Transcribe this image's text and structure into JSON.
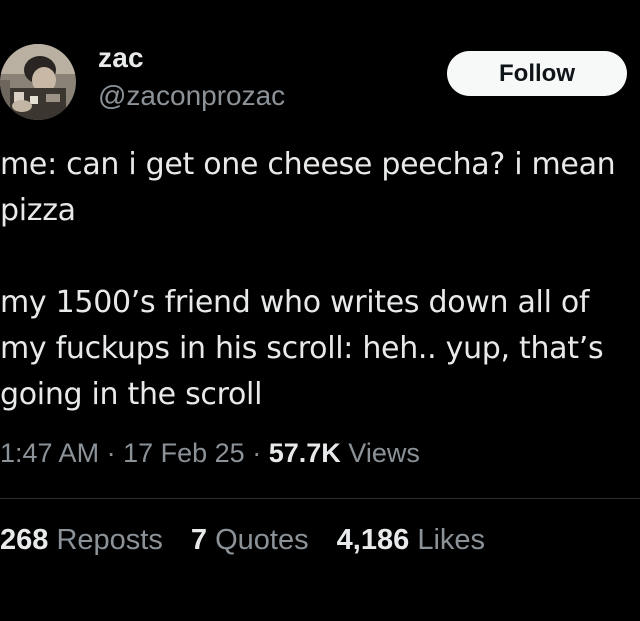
{
  "author": {
    "display_name": "zac",
    "handle": "@zaconprozac"
  },
  "follow_button": {
    "label": "Follow"
  },
  "tweet": {
    "paragraphs": [
      "me: can i get one cheese peecha? i mean pizza",
      "my 1500’s friend who writes down all of my fuckups in his scroll: heh.. yup, that’s going in the scroll"
    ],
    "time": "1:47 AM",
    "date": "17 Feb 25",
    "separator": "·",
    "views_count": "57.7K",
    "views_label": "Views"
  },
  "stats": {
    "reposts_count": "268",
    "reposts_label": "Reposts",
    "quotes_count": "7",
    "quotes_label": "Quotes",
    "likes_count": "4,186",
    "likes_label": "Likes"
  },
  "colors": {
    "background": "#000000",
    "primary_text": "#e7e9ea",
    "secondary_text": "#8b9298",
    "follow_button_bg": "#f7f9f9",
    "divider": "#2a2e32"
  }
}
